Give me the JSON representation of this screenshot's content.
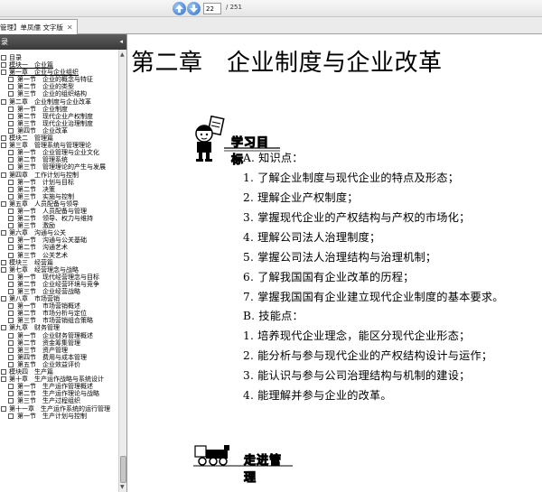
{
  "toolbar": {
    "prev_page_icon": "arrow-up-icon",
    "next_page_icon": "arrow-down-icon",
    "current_page": "22",
    "total_pages": "/ 251"
  },
  "tab": {
    "title": "管理】单凤儒 文字版",
    "close_icon": "close-icon"
  },
  "panel": {
    "title": "录",
    "collapse_icon": "collapse-icon",
    "items": [
      {
        "level": 1,
        "label": "目录"
      },
      {
        "level": 1,
        "label": "模块一　企业篇",
        "underline": true
      },
      {
        "level": 1,
        "label": "第一章　企业与企业组织",
        "underline": true
      },
      {
        "level": 2,
        "label": "第一节　企业的概念与特征"
      },
      {
        "level": 2,
        "label": "第二节　企业的类型"
      },
      {
        "level": 2,
        "label": "第三节　企业的组织结构"
      },
      {
        "level": 1,
        "label": "第二章　企业制度与企业改革"
      },
      {
        "level": 2,
        "label": "第一节　企业制度"
      },
      {
        "level": 2,
        "label": "第二节　现代企业产权制度"
      },
      {
        "level": 2,
        "label": "第三节　现代企业治理制度"
      },
      {
        "level": 2,
        "label": "第四节　企业改革"
      },
      {
        "level": 1,
        "label": "模块二　管理篇"
      },
      {
        "level": 1,
        "label": "第三章　管理系统与管理理论"
      },
      {
        "level": 2,
        "label": "第一节　企业管理与企业文化"
      },
      {
        "level": 2,
        "label": "第二节　管理系统"
      },
      {
        "level": 2,
        "label": "第三节　管理理论的产生与发展"
      },
      {
        "level": 1,
        "label": "第四章　工作计划与控制"
      },
      {
        "level": 2,
        "label": "第一节　计划与目标"
      },
      {
        "level": 2,
        "label": "第二节　决策"
      },
      {
        "level": 2,
        "label": "第三节　实施与控制"
      },
      {
        "level": 1,
        "label": "第五章　人员配备与领导"
      },
      {
        "level": 2,
        "label": "第一节　人员配备与管理"
      },
      {
        "level": 2,
        "label": "第二节　领导、权力与维持"
      },
      {
        "level": 2,
        "label": "第三节　激励"
      },
      {
        "level": 1,
        "label": "第六章　沟通与公关"
      },
      {
        "level": 2,
        "label": "第一节　沟通与公关基础"
      },
      {
        "level": 2,
        "label": "第二节　沟通艺术"
      },
      {
        "level": 2,
        "label": "第三节　公关艺术"
      },
      {
        "level": 1,
        "label": "模块三　经营篇"
      },
      {
        "level": 1,
        "label": "第七章　经营理念与战略"
      },
      {
        "level": 2,
        "label": "第一节　现代经营理念与目标"
      },
      {
        "level": 2,
        "label": "第二节　企业经营环境与竞争"
      },
      {
        "level": 2,
        "label": "第三节　企业经营战略"
      },
      {
        "level": 1,
        "label": "第八章　市场营销"
      },
      {
        "level": 2,
        "label": "第一节　市场营销概述"
      },
      {
        "level": 2,
        "label": "第二节　市场分析与定位"
      },
      {
        "level": 2,
        "label": "第三节　市场营销组合策略"
      },
      {
        "level": 1,
        "label": "第九章　财务管理"
      },
      {
        "level": 2,
        "label": "第一节　企业财务管理概述"
      },
      {
        "level": 2,
        "label": "第二节　资金筹集管理"
      },
      {
        "level": 2,
        "label": "第三节　资产管理"
      },
      {
        "level": 2,
        "label": "第四节　费用与成本管理"
      },
      {
        "level": 2,
        "label": "第五节　企业效益评价"
      },
      {
        "level": 1,
        "label": "模块四　生产篇"
      },
      {
        "level": 1,
        "label": "第十章　生产运作战略与系统设计"
      },
      {
        "level": 2,
        "label": "第一节　生产运作管理概述"
      },
      {
        "level": 2,
        "label": "第二节　生产运作理论与战略"
      },
      {
        "level": 2,
        "label": "第三节　生产过程组织"
      },
      {
        "level": 1,
        "label": "第十一章　生产运作系统的运行管理"
      },
      {
        "level": 2,
        "label": "第一节　生产计划与控制"
      }
    ]
  },
  "document": {
    "chapter_title": "第二章　企业制度与企业改革",
    "objectives_banner": "学习目标",
    "lines": [
      "A. 知识点：",
      "1. 了解企业制度与现代企业的特点及形态；",
      "2. 理解企业产权制度；",
      "3. 掌握现代企业的产权结构与产权的市场化；",
      "4. 理解公司法人治理制度；",
      "5. 掌握公司法人治理结构与治理机制；",
      "6. 了解我国国有企业改革的历程；",
      "7. 掌握我国国有企业建立现代企业制度的基本要求。",
      "B. 技能点：",
      "1. 培养现代企业理念，能区分现代企业形态；",
      "2. 能分析与参与现代企业的产权结构设计与运作；",
      "3. 能认识与参与公司治理结构与机制的建设；",
      "4. 能理解并参与企业的改革。"
    ],
    "management_banner": "走进管理"
  }
}
